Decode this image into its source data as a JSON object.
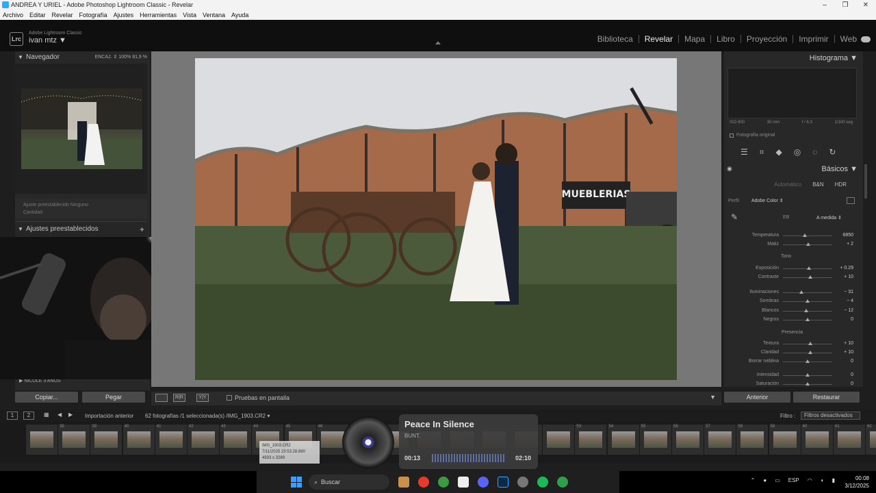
{
  "window": {
    "title": "ANDREA Y URIEL - Adobe Photoshop Lightroom Classic - Revelar"
  },
  "menu": [
    "Archivo",
    "Editar",
    "Revelar",
    "Fotografía",
    "Ajustes",
    "Herramientas",
    "Vista",
    "Ventana",
    "Ayuda"
  ],
  "identity": {
    "logo": "Lrc",
    "app": "Adobe Lightroom Classic",
    "user": "ivan mtz ▼"
  },
  "modules": [
    "Biblioteca",
    "Revelar",
    "Mapa",
    "Libro",
    "Proyección",
    "Imprimir",
    "Web"
  ],
  "left": {
    "navigator": "Navegador",
    "zoom": "ENCAJ. ⇕   100%   81,9 %",
    "preset_amount": "Ajuste preestablecido   Ninguno",
    "amount": "Cantidad",
    "presets": "Ajustes preestablecidos",
    "nicole": "NICOLE 3 AÑOS",
    "copy": "Copiar...",
    "paste": "Pegar"
  },
  "center": {
    "proof": "Pruebas en pantalla"
  },
  "right": {
    "histogram": "Histograma",
    "meta": [
      "ISO 800",
      "30 mm",
      "f / 6.3",
      "1/100 seg"
    ],
    "original": "Fotografía original",
    "basics": "Básicos",
    "treatments": [
      "Automático",
      "B&N",
      "HDR"
    ],
    "profile_label": "Perfil",
    "profile_value": "Adobe Color ⇕",
    "wb_label": "EB",
    "wb_value": "A medida ⇕",
    "tone": "Tono",
    "presence": "Presencia",
    "prev": "Anterior",
    "reset": "Restaurar",
    "sliders": [
      {
        "label": "Temperatura",
        "value": "6850",
        "pos": 0.45
      },
      {
        "label": "Matiz",
        "value": "+ 2",
        "pos": 0.52
      },
      {
        "label": "Exposición",
        "value": "+ 0.29",
        "pos": 0.53
      },
      {
        "label": "Contraste",
        "value": "+ 10",
        "pos": 0.55
      },
      {
        "label": "Iluminaciones",
        "value": "− 31",
        "pos": 0.38
      },
      {
        "label": "Sombras",
        "value": "− 4",
        "pos": 0.5
      },
      {
        "label": "Blancos",
        "value": "− 12",
        "pos": 0.47
      },
      {
        "label": "Negros",
        "value": "0",
        "pos": 0.5
      },
      {
        "label": "Textura",
        "value": "+ 10",
        "pos": 0.55
      },
      {
        "label": "Claridad",
        "value": "+ 10",
        "pos": 0.55
      },
      {
        "label": "Borrar neblina",
        "value": "0",
        "pos": 0.5
      },
      {
        "label": "Intensidad",
        "value": "0",
        "pos": 0.5
      },
      {
        "label": "Saturación",
        "value": "0",
        "pos": 0.5
      }
    ]
  },
  "filmbar": {
    "btn1": "1",
    "btn2": "2",
    "source": "Importación anterior",
    "count": "62 fotografías /1 seleccionada(s) /IMG_1903.CR2 ▾",
    "filter_label": "Filtro :",
    "filter_value": "Filtros desactivados"
  },
  "thumbs": [
    "",
    "38",
    "39",
    "40",
    "41",
    "42",
    "43",
    "44",
    "45",
    "46",
    "",
    "",
    "",
    "",
    "",
    "",
    "",
    "53",
    "54",
    "55",
    "56",
    "57",
    "58",
    "59",
    "60",
    "61",
    "62"
  ],
  "tooltip": {
    "l1": "IMG_1903.CR2",
    "l2": "7/11/2025 23:53:28.890",
    "l3": "4933 x 3289"
  },
  "music": {
    "title": "Peace In Silence",
    "artist": "BUNT.",
    "elapsed": "00:13",
    "total": "02:10"
  },
  "taskbar": {
    "search": "Buscar",
    "lang": "ESP",
    "time": "00:08",
    "date": "3/12/2025"
  }
}
